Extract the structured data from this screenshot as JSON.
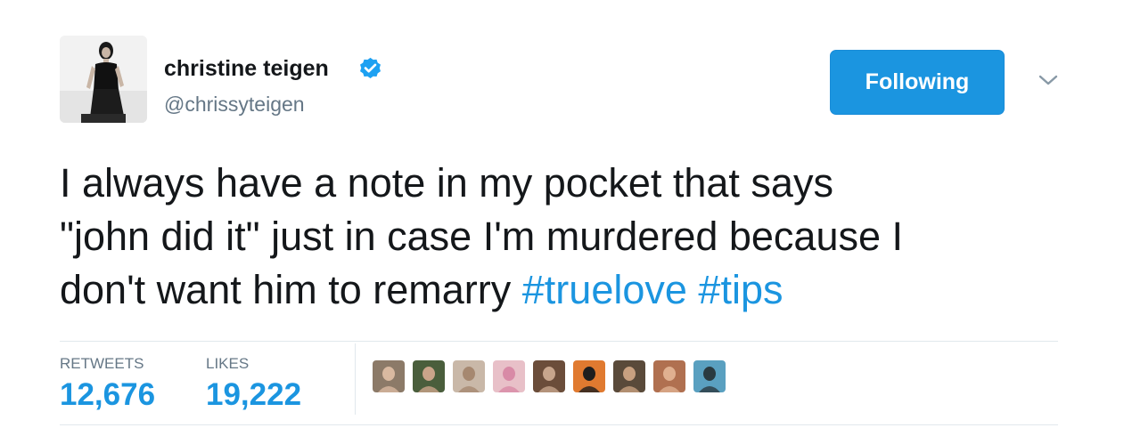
{
  "tweet": {
    "author": {
      "display_name": "christine teigen",
      "handle": "@chrissyteigen",
      "verified": true,
      "verified_badge_icon": "verified-badge-icon"
    },
    "follow_button_label": "Following",
    "menu_icon": "chevron-down-icon",
    "text_lines": [
      {
        "text": "I always have a note in my pocket that says"
      },
      {
        "text": "\"john did it\" just in case I'm murdered because I"
      },
      {
        "text": "don't want him to remarry ",
        "hashtags": [
          "#truelove",
          "#tips"
        ]
      }
    ],
    "stats": {
      "retweets_label": "RETWEETS",
      "retweets_value": "12,676",
      "likes_label": "LIKES",
      "likes_value": "19,222"
    },
    "liker_avatars": [
      {
        "icon": "liker-avatar-1",
        "colors": [
          "#8c7a68",
          "#d9b9a0"
        ]
      },
      {
        "icon": "liker-avatar-2",
        "colors": [
          "#4a5e3c",
          "#caa48a"
        ]
      },
      {
        "icon": "liker-avatar-3",
        "colors": [
          "#c9b8a8",
          "#a68870"
        ]
      },
      {
        "icon": "liker-avatar-4",
        "colors": [
          "#e8c0c8",
          "#d88aa6"
        ]
      },
      {
        "icon": "liker-avatar-5",
        "colors": [
          "#6b4d3a",
          "#c7a58c"
        ]
      },
      {
        "icon": "liker-avatar-6",
        "colors": [
          "#e07a30",
          "#1e1e1e"
        ]
      },
      {
        "icon": "liker-avatar-7",
        "colors": [
          "#5a4a3a",
          "#c8a080"
        ]
      },
      {
        "icon": "liker-avatar-8",
        "colors": [
          "#b07050",
          "#e0b090"
        ]
      },
      {
        "icon": "liker-avatar-9",
        "colors": [
          "#5aa0c0",
          "#2a3a40"
        ]
      }
    ],
    "colors": {
      "accent": "#1b95e0",
      "text": "#14171a",
      "secondary": "#657786",
      "divider": "#e1e8ed"
    }
  }
}
